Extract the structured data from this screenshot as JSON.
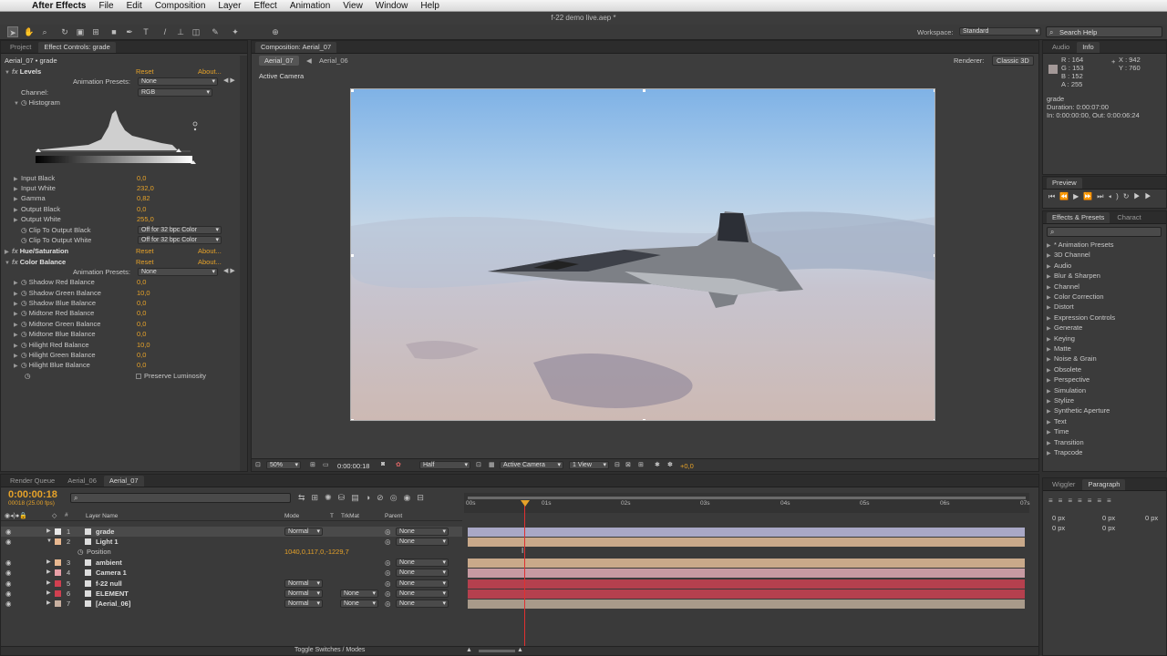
{
  "menubar": {
    "apple_icon": "apple-icon",
    "app_name": "After Effects",
    "items": [
      "File",
      "Edit",
      "Composition",
      "Layer",
      "Effect",
      "Animation",
      "View",
      "Window",
      "Help"
    ]
  },
  "window_title": "f-22 demo live.aep *",
  "toolbar": {
    "workspace_label": "Workspace:",
    "workspace_value": "Standard",
    "search_help": "Search Help"
  },
  "effect_controls": {
    "tabs": [
      "Project",
      "Effect Controls: grade"
    ],
    "layer_label": "Aerial_07 • grade",
    "levels": {
      "name": "Levels",
      "reset": "Reset",
      "about": "About...",
      "presets_label": "Animation Presets:",
      "presets_value": "None",
      "channel_label": "Channel:",
      "channel_value": "RGB",
      "histogram_label": "Histogram",
      "props": [
        {
          "name": "Input Black",
          "value": "0,0"
        },
        {
          "name": "Input White",
          "value": "232,0"
        },
        {
          "name": "Gamma",
          "value": "0,82"
        },
        {
          "name": "Output Black",
          "value": "0,0"
        },
        {
          "name": "Output White",
          "value": "255,0"
        }
      ],
      "clip_black_label": "Clip To Output Black",
      "clip_black_value": "Off for 32 bpc Color",
      "clip_white_label": "Clip To Output White",
      "clip_white_value": "Off for 32 bpc Color"
    },
    "hue_sat": {
      "name": "Hue/Saturation",
      "reset": "Reset",
      "about": "About..."
    },
    "color_balance": {
      "name": "Color Balance",
      "reset": "Reset",
      "about": "About...",
      "presets_label": "Animation Presets:",
      "presets_value": "None",
      "props": [
        {
          "name": "Shadow Red Balance",
          "value": "0,0"
        },
        {
          "name": "Shadow Green Balance",
          "value": "10,0"
        },
        {
          "name": "Shadow Blue Balance",
          "value": "0,0"
        },
        {
          "name": "Midtone Red Balance",
          "value": "0,0"
        },
        {
          "name": "Midtone Green Balance",
          "value": "0,0"
        },
        {
          "name": "Midtone Blue Balance",
          "value": "0,0"
        },
        {
          "name": "Hilight Red Balance",
          "value": "10,0"
        },
        {
          "name": "Hilight Green Balance",
          "value": "0,0"
        },
        {
          "name": "Hilight Blue Balance",
          "value": "0,0"
        }
      ],
      "preserve_label": "Preserve Luminosity"
    }
  },
  "composition": {
    "tab": "Composition: Aerial_07",
    "crumbs": [
      "Aerial_07",
      "Aerial_06"
    ],
    "renderer_label": "Renderer:",
    "renderer_value": "Classic 3D",
    "active_camera": "Active Camera",
    "footer": {
      "zoom": "50%",
      "timecode": "0:00:00:18",
      "resolution": "Half",
      "camera": "Active Camera",
      "views": "1 View",
      "exposure": "+0,0"
    }
  },
  "info": {
    "tabs": [
      "Audio",
      "Info"
    ],
    "r": "R : 164",
    "g": "G : 153",
    "b": "B : 152",
    "a": "A : 255",
    "x": "X : 942",
    "y": "Y : 760",
    "layer": "grade",
    "duration": "Duration: 0:00:07:00",
    "inout": "In: 0:00:00:00, Out: 0:00:06:24"
  },
  "preview": {
    "tab": "Preview"
  },
  "effects_presets": {
    "tabs": [
      "Effects & Presets",
      "Charact"
    ],
    "items": [
      "* Animation Presets",
      "3D Channel",
      "Audio",
      "Blur & Sharpen",
      "Channel",
      "Color Correction",
      "Distort",
      "Expression Controls",
      "Generate",
      "Keying",
      "Matte",
      "Noise & Grain",
      "Obsolete",
      "Perspective",
      "Simulation",
      "Stylize",
      "Synthetic Aperture",
      "Text",
      "Time",
      "Transition",
      "Trapcode"
    ]
  },
  "timeline": {
    "tabs": [
      "Render Queue",
      "Aerial_06",
      "Aerial_07"
    ],
    "timecode": "0:00:00:18",
    "fps": "00018 (25.00 fps)",
    "col_layer_name": "Layer Name",
    "col_mode": "Mode",
    "col_t": "T",
    "col_trkmat": "TrkMat",
    "col_parent": "Parent",
    "ruler": [
      "00s",
      "01s",
      "02s",
      "03s",
      "04s",
      "05s",
      "06s",
      "07s"
    ],
    "layers": [
      {
        "num": "1",
        "name": "grade",
        "mode": "Normal",
        "trkmat": "",
        "parent": "None",
        "color": "#e8e8e8",
        "bar": "#a9a8c6"
      },
      {
        "num": "2",
        "name": "Light 1",
        "mode": "",
        "trkmat": "",
        "parent": "None",
        "color": "#e8b890",
        "bar": "#c9a98a"
      },
      {
        "num": "3",
        "name": "ambient",
        "mode": "",
        "trkmat": "",
        "parent": "None",
        "color": "#e8b890",
        "bar": "#c9a98a"
      },
      {
        "num": "4",
        "name": "Camera 1",
        "mode": "",
        "trkmat": "",
        "parent": "None",
        "color": "#e8a0a8",
        "bar": "#c79aa2"
      },
      {
        "num": "5",
        "name": "f-22 null",
        "mode": "Normal",
        "trkmat": "",
        "parent": "None",
        "color": "#d04050",
        "bar": "#b5404e"
      },
      {
        "num": "6",
        "name": "ELEMENT",
        "mode": "Normal",
        "trkmat": "None",
        "parent": "None",
        "color": "#d04050",
        "bar": "#b5404e"
      },
      {
        "num": "7",
        "name": "[Aerial_06]",
        "mode": "Normal",
        "trkmat": "None",
        "parent": "None",
        "color": "#c8b0a0",
        "bar": "#a89a8a"
      }
    ],
    "position_label": "Position",
    "position_value": "1040,0,117,0,-1229,7",
    "toggle_label": "Toggle Switches / Modes"
  },
  "right_bottom": {
    "tabs": [
      "Wiggler",
      "Paragraph"
    ],
    "spacing": [
      "0 px",
      "0 px",
      "0 px",
      "0 px",
      "0 px"
    ]
  }
}
